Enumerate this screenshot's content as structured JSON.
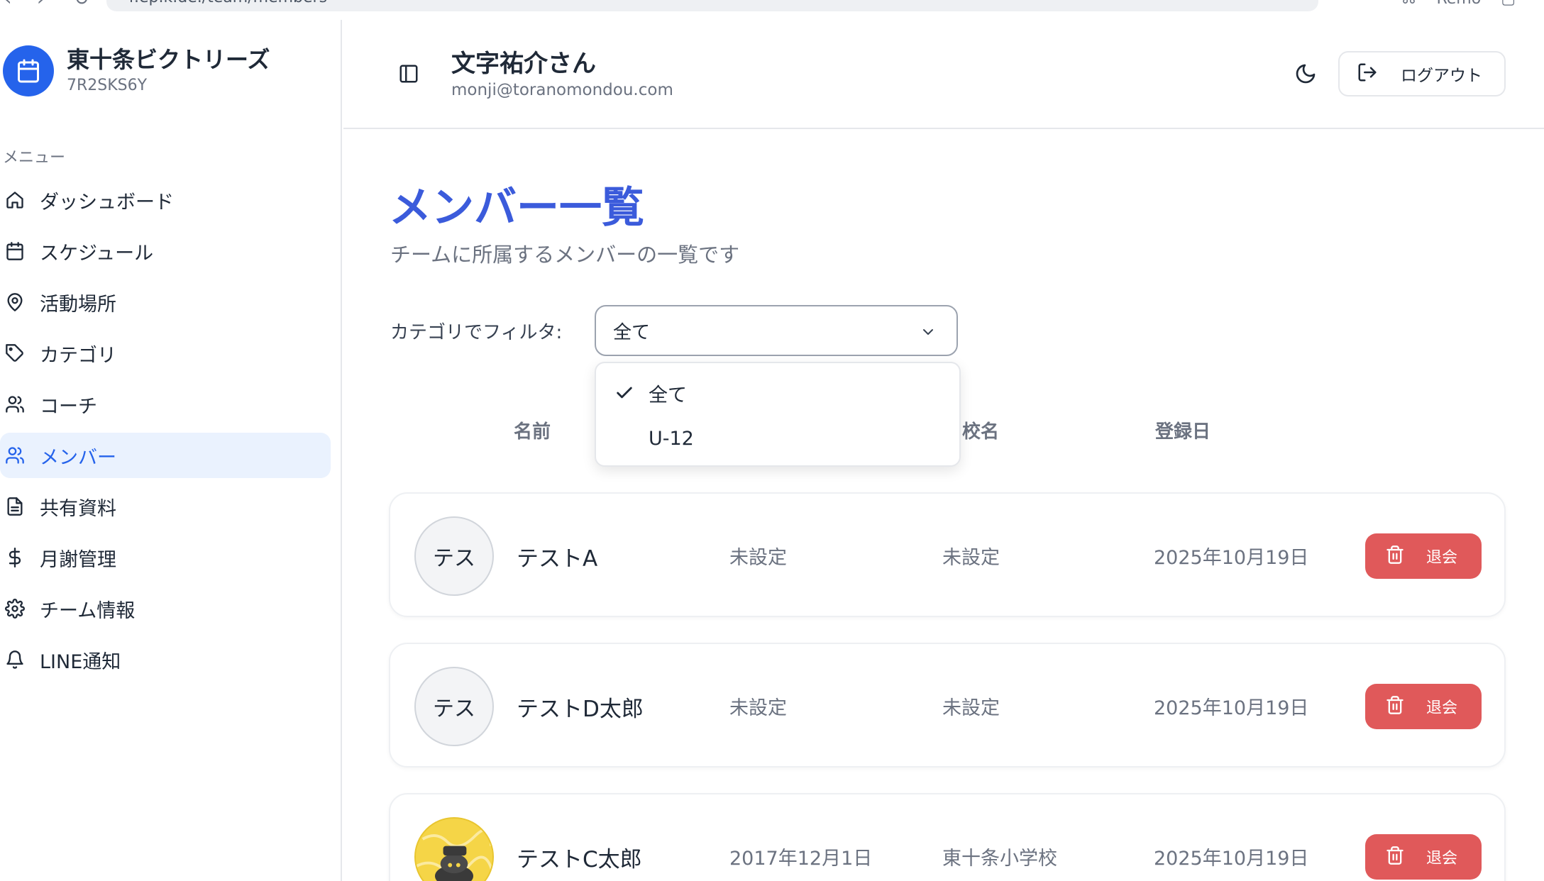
{
  "browser": {
    "url": "r.ep.k.de./team/members",
    "right_text": "Remo"
  },
  "brand": {
    "name": "東十条ビクトリーズ",
    "code": "7R2SKS6Y"
  },
  "sidebar": {
    "heading": "メニュー",
    "items": [
      {
        "label": "ダッシュボード",
        "icon": "home-icon"
      },
      {
        "label": "スケジュール",
        "icon": "calendar-icon"
      },
      {
        "label": "活動場所",
        "icon": "map-pin-icon"
      },
      {
        "label": "カテゴリ",
        "icon": "tag-icon"
      },
      {
        "label": "コーチ",
        "icon": "users-icon"
      },
      {
        "label": "メンバー",
        "icon": "users-icon",
        "active": true
      },
      {
        "label": "共有資料",
        "icon": "file-text-icon"
      },
      {
        "label": "月謝管理",
        "icon": "dollar-icon"
      },
      {
        "label": "チーム情報",
        "icon": "gear-icon"
      },
      {
        "label": "LINE通知",
        "icon": "bell-icon"
      }
    ]
  },
  "header": {
    "user_name": "文字祐介さん",
    "user_email": "monji@toranomondou.com",
    "logout_label": "ログアウト"
  },
  "main": {
    "title": "メンバー一覧",
    "subtitle": "チームに所属するメンバーの一覧です",
    "filter": {
      "label": "カテゴリでフィルタ:",
      "selected": "全て",
      "options": [
        {
          "label": "全て",
          "checked": true
        },
        {
          "label": "U-12",
          "checked": false
        }
      ]
    },
    "columns": {
      "name": "名前",
      "school": "校名",
      "registered": "登録日"
    },
    "members": [
      {
        "avatar_text": "テス",
        "name": "テストA",
        "birth": "未設定",
        "school": "未設定",
        "registered": "2025年10月19日",
        "leave_label": "退会",
        "avatar_image": false
      },
      {
        "avatar_text": "テス",
        "name": "テストD太郎",
        "birth": "未設定",
        "school": "未設定",
        "registered": "2025年10月19日",
        "leave_label": "退会",
        "avatar_image": false
      },
      {
        "avatar_text": "",
        "name": "テストC太郎",
        "birth": "2017年12月1日",
        "school": "東十条小学校",
        "registered": "2025年10月19日",
        "leave_label": "退会",
        "avatar_image": true
      }
    ]
  },
  "colors": {
    "accent": "#2563eb",
    "title": "#3b5bdb",
    "danger": "#e0595a",
    "active_bg": "#eaf2fe"
  }
}
